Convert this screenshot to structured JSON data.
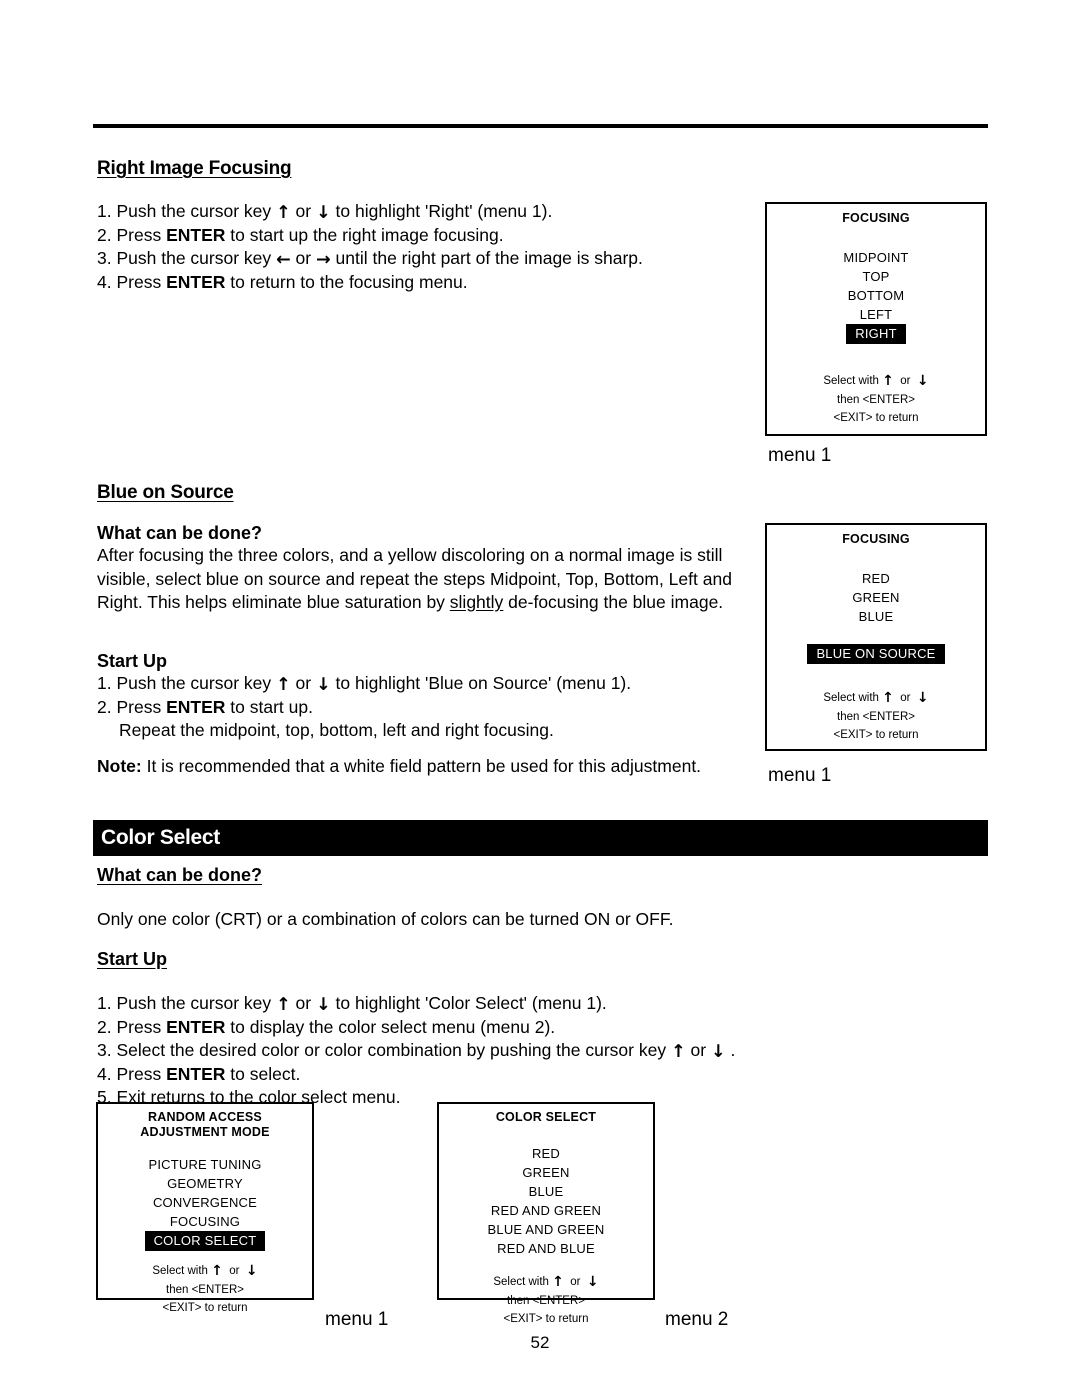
{
  "document": {
    "page_number": "52"
  },
  "sections": {
    "right_image_focusing": {
      "heading": "Right Image Focusing",
      "steps": [
        {
          "num": "1.",
          "pre": "Push the cursor key ",
          "arrow1": "up",
          "mid": " or ",
          "arrow2": "down",
          "post": " to highlight 'Right' (menu 1)."
        },
        {
          "num": "2.",
          "pre": "Press ",
          "bold": "ENTER",
          "post": " to start up the right image focusing."
        },
        {
          "num": "3.",
          "pre": "Push the cursor key ",
          "arrow1": "left",
          "mid": " or ",
          "arrow2": "right",
          "post": " until the right part of the image is sharp."
        },
        {
          "num": "4.",
          "pre": "Press ",
          "bold": "ENTER",
          "post": " to return to the focusing menu."
        }
      ]
    },
    "blue_on_source": {
      "heading": "Blue on Source",
      "what_can_be_done_label": "What can be done?",
      "what_can_be_done_text_1": "After focusing the three colors, and a yellow discoloring on a normal image is still visible, select blue on source and repeat the steps Midpoint, Top, Bottom, Left and Right. This helps eliminate blue saturation by ",
      "what_can_be_done_underlined": "slightly",
      "what_can_be_done_text_2": " de-focusing the blue image.",
      "start_up_label": "Start Up",
      "steps": [
        {
          "num": "1.",
          "pre": "Push the cursor key ",
          "arrow1": "up",
          "mid": " or ",
          "arrow2": "down",
          "post": " to highlight 'Blue on Source' (menu 1)."
        },
        {
          "num": "2.",
          "pre": "Press ",
          "bold": "ENTER",
          "post": " to start up."
        }
      ],
      "step_continuation": "Repeat the midpoint, top, bottom, left and right focusing.",
      "note_label": "Note:",
      "note_text": " It is recommended that a white field pattern be used for this adjustment."
    },
    "color_select": {
      "banner_title": "Color Select",
      "what_can_be_done_label": "What can be done?",
      "what_can_be_done_text": "Only one color (CRT) or a combination of colors can be turned ON or OFF.",
      "start_up_label": "Start Up",
      "steps": [
        {
          "num": "1.",
          "pre": "Push the cursor key ",
          "arrow1": "up",
          "mid": " or ",
          "arrow2": "down",
          "post": " to highlight 'Color Select' (menu 1)."
        },
        {
          "num": "2.",
          "pre": "Press ",
          "bold": "ENTER",
          "post": " to display the color select menu (menu 2)."
        },
        {
          "num": "3.",
          "pre": "Select the desired color or color combination by pushing the cursor key ",
          "arrow1": "up",
          "mid": " or ",
          "arrow2": "down",
          "post": " ."
        },
        {
          "num": "4.",
          "pre": "Press ",
          "bold": "ENTER",
          "post": " to select."
        },
        {
          "num": "5.",
          "pre": "Exit returns to the color select menu."
        }
      ]
    }
  },
  "menus": {
    "focusing_positions": {
      "title": "FOCUSING",
      "items": [
        "MIDPOINT",
        "TOP",
        "BOTTOM",
        "LEFT"
      ],
      "highlighted": "RIGHT",
      "footer": {
        "select_with": "Select with",
        "or": "or",
        "then_enter": "then <ENTER>",
        "exit_to_return": "<EXIT> to return"
      },
      "caption": "menu 1"
    },
    "focusing_colors": {
      "title": "FOCUSING",
      "items": [
        "RED",
        "GREEN",
        "BLUE"
      ],
      "highlighted": "BLUE ON SOURCE",
      "footer": {
        "select_with": "Select with",
        "or": "or",
        "then_enter": "then <ENTER>",
        "exit_to_return": "<EXIT> to return"
      },
      "caption": "menu 1"
    },
    "random_access": {
      "title_line1": "RANDOM ACCESS",
      "title_line2": "ADJUSTMENT MODE",
      "items": [
        "PICTURE TUNING",
        "GEOMETRY",
        "CONVERGENCE",
        "FOCUSING"
      ],
      "highlighted": "COLOR SELECT",
      "footer": {
        "select_with": "Select with",
        "or": "or",
        "then_enter": "then <ENTER>",
        "exit_to_return": "<EXIT> to return"
      },
      "caption": "menu 1"
    },
    "color_select_menu": {
      "title": "COLOR SELECT",
      "items": [
        "RED",
        "GREEN",
        "BLUE",
        "RED AND GREEN",
        "BLUE AND GREEN",
        "RED AND BLUE"
      ],
      "footer": {
        "select_with": "Select with",
        "or": "or",
        "then_enter": "then <ENTER>",
        "exit_to_return": "<EXIT> to return"
      },
      "caption": "menu 2"
    }
  }
}
